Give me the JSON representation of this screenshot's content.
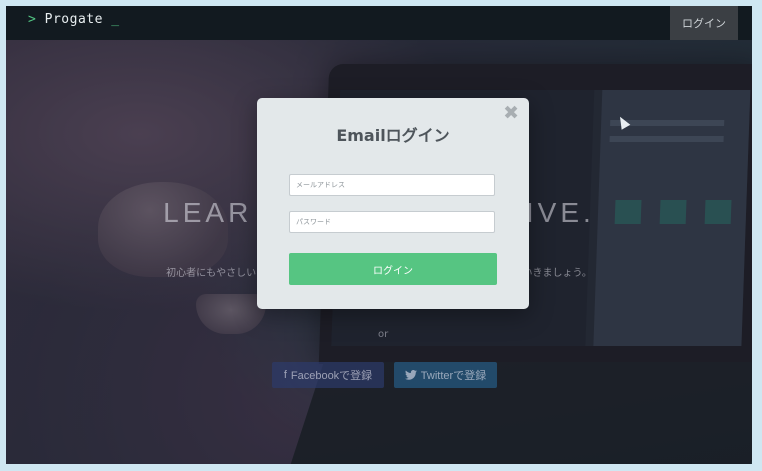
{
  "header": {
    "logo_arrow": ">",
    "logo_text": "Progate",
    "logo_cursor": "_",
    "login_label": "ログイン"
  },
  "hero": {
    "line1": "L",
    "line2_left": "LEAR",
    "line2_right": "IVE.",
    "subtitle_left": "初心者にもやさしいス",
    "subtitle_right": "ていきましょう。",
    "or_label": "or",
    "facebook_icon": "f",
    "facebook_label": "Facebookで登録",
    "twitter_icon": "twitter-icon",
    "twitter_label": "Twitterで登録"
  },
  "modal": {
    "close_symbol": "✖",
    "title": "Emailログイン",
    "email_placeholder": "メールアドレス",
    "password_placeholder": "パスワード",
    "submit_label": "ログイン"
  },
  "colors": {
    "brand_green": "#56c582",
    "header_bg": "#121a20",
    "modal_bg": "#e3e8ea",
    "title_color": "#4e555b"
  }
}
